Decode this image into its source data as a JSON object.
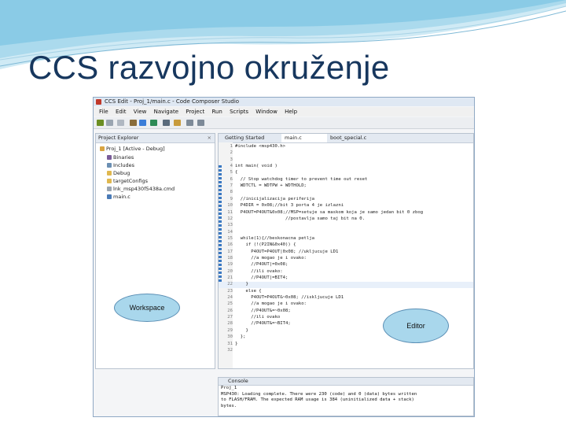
{
  "slide": {
    "title": "CCS razvojno okruženje"
  },
  "window": {
    "title": "CCS Edit - Proj_1/main.c - Code Composer Studio"
  },
  "menu": [
    "File",
    "Edit",
    "View",
    "Navigate",
    "Project",
    "Run",
    "Scripts",
    "Window",
    "Help"
  ],
  "project_explorer": {
    "title": "Project Explorer",
    "items": [
      {
        "label": "Proj_1 [Active - Debug]",
        "icon": "project-folder-icon"
      },
      {
        "label": "Binaries",
        "icon": "binaries-icon"
      },
      {
        "label": "Includes",
        "icon": "includes-icon"
      },
      {
        "label": "Debug",
        "icon": "folder-icon"
      },
      {
        "label": "targetConfigs",
        "icon": "folder-icon"
      },
      {
        "label": "lnk_msp430f5438a.cmd",
        "icon": "file-icon"
      },
      {
        "label": "main.c",
        "icon": "c-file-icon"
      }
    ]
  },
  "editor": {
    "tabs": [
      "Getting Started",
      "main.c",
      "boot_special.c"
    ],
    "active_tab": "main.c",
    "lines": [
      {
        "n": "1",
        "t": "#include <msp430.h>"
      },
      {
        "n": "2",
        "t": ""
      },
      {
        "n": "3",
        "t": ""
      },
      {
        "n": "4",
        "t": "int main( void )"
      },
      {
        "n": "5",
        "t": "{"
      },
      {
        "n": "6",
        "t": "  // Stop watchdog timer to prevent time out reset"
      },
      {
        "n": "7",
        "t": "  WDTCTL = WDTPW + WDTHOLD;"
      },
      {
        "n": "8",
        "t": ""
      },
      {
        "n": "9",
        "t": "  //inicijalizacija periferija"
      },
      {
        "n": "10",
        "t": "  P4DIR = 0x08;//bit 3 porta 4 je izlazni"
      },
      {
        "n": "11",
        "t": "  P4OUT=P4OUT&0x08;//MSP=setuje sa maskom koja je samo jedan bit 0 zbog"
      },
      {
        "n": "12",
        "t": "                   //postavlja samo taj bit na 0."
      },
      {
        "n": "13",
        "t": ""
      },
      {
        "n": "14",
        "t": ""
      },
      {
        "n": "15",
        "t": "  while(1){//beskonacna petlja"
      },
      {
        "n": "16",
        "t": "    if (!(P2IN&0x40)) {"
      },
      {
        "n": "17",
        "t": "      P4OUT=P4OUT|0x08; //ukljucuje LD1"
      },
      {
        "n": "18",
        "t": "      //a mogao je i ovako:"
      },
      {
        "n": "19",
        "t": "      //P4OUT|=0x08;"
      },
      {
        "n": "20",
        "t": "      //ili ovako:"
      },
      {
        "n": "21",
        "t": "      //P4OUT|=BIT4;"
      },
      {
        "n": "22",
        "t": "    }"
      },
      {
        "n": "23",
        "t": "    else {"
      },
      {
        "n": "24",
        "t": "      P4OUT=P4OUT&~0x08; //iskljucuje LD1"
      },
      {
        "n": "25",
        "t": "      //a mogao je i ovako:"
      },
      {
        "n": "26",
        "t": "      //P4OUT&=~0x08;"
      },
      {
        "n": "27",
        "t": "      //ili ovako"
      },
      {
        "n": "28",
        "t": "      //P4OUT&=~BIT4;"
      },
      {
        "n": "29",
        "t": "    }"
      },
      {
        "n": "30",
        "t": "  };"
      },
      {
        "n": "31",
        "t": "}"
      },
      {
        "n": "32",
        "t": ""
      }
    ],
    "highlighted_line": "22"
  },
  "console": {
    "tab": "Console",
    "project": "Proj_1",
    "lines": [
      "MSP430: Loading complete. There were 230 (code) and 0 (data) bytes written",
      "to FLASH/FRAM. The expected RAM usage is 384 (uninitialized data + stack)",
      "bytes."
    ]
  },
  "callouts": {
    "workspace": "Workspace",
    "editor": "Editor"
  },
  "colors": {
    "title": "#17375e",
    "callout_fill": "#a9d7ec",
    "wave": "#7fc6e4"
  }
}
